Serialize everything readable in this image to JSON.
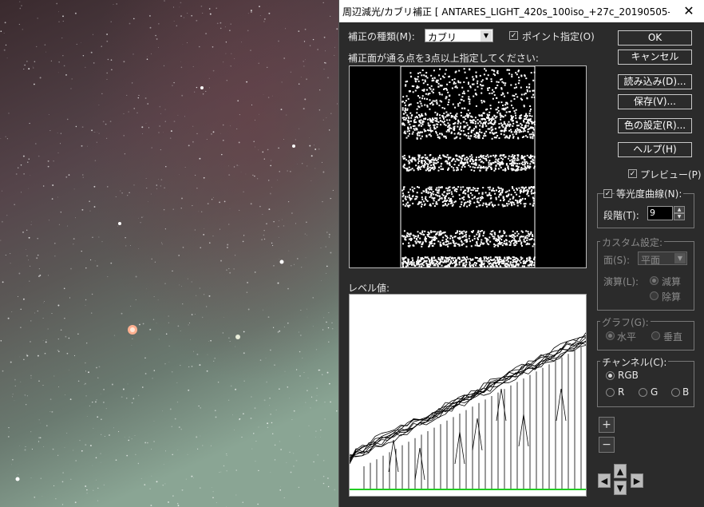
{
  "window": {
    "title": "周辺減光/カブリ補正 [ ANTARES_LIGHT_420s_100iso_+27c_20190505-02h07m02...",
    "close_glyph": "✕"
  },
  "correction": {
    "type_label": "補正の種類(M):",
    "type_value": "カブリ",
    "point_label": "ポイント指定(O)",
    "point_checked": true,
    "instruction": "補正面が通る点を3点以上指定してください:"
  },
  "buttons": {
    "ok": "OK",
    "cancel": "キャンセル",
    "load": "読み込み(D)...",
    "save": "保存(V)...",
    "color": "色の設定(R)...",
    "help": "ヘルプ(H)"
  },
  "preview": {
    "label": "プレビュー(P)",
    "checked": true
  },
  "contour": {
    "label": "等光度曲線(N):",
    "checked": true,
    "steps_label": "段階(T):",
    "steps_value": "9"
  },
  "custom": {
    "title": "カスタム設定:",
    "surface_label": "面(S):",
    "surface_value": "平面",
    "calc_label": "演算(L):",
    "subtract": "減算",
    "divide": "除算"
  },
  "graph": {
    "title": "グラフ(G):",
    "horizontal": "水平",
    "vertical": "垂直"
  },
  "channel": {
    "title": "チャンネル(C):",
    "rgb": "RGB",
    "r": "R",
    "g": "G",
    "b": "B",
    "selected": "RGB"
  },
  "level": {
    "label": "レベル値:"
  },
  "zoom": {
    "plus": "+",
    "minus": "−"
  },
  "nav": {
    "up": "▲",
    "down": "▼",
    "left": "◀",
    "right": "▶"
  },
  "icons": {
    "close": "close-icon",
    "dropdown": "chevron-down-icon",
    "spin_up": "spin-up-icon",
    "spin_down": "spin-down-icon"
  },
  "colors": {
    "dialog_bg": "#2b2b2b",
    "graph_baseline": "#22cc22"
  }
}
